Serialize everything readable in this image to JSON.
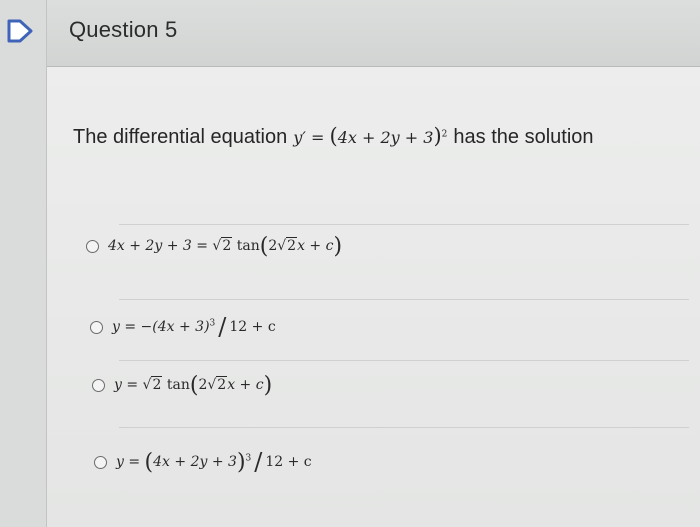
{
  "question": {
    "title": "Question 5",
    "text_before": "The differential equation",
    "equation": {
      "lhs": "y′ =",
      "open": "(",
      "inner": "4x + 2y + 3",
      "close": ")",
      "power": "2"
    },
    "text_after": "has the solution"
  },
  "options": [
    {
      "lhs": "4x + 2y + 3 =",
      "root_sign": "√",
      "root": "2",
      "func": "tan",
      "open": "(",
      "arg_a": "2",
      "arg_root_sign": "√",
      "arg_root": "2",
      "arg_b": "x + c",
      "close": ")"
    },
    {
      "lhs": "y = −(4x + 3)",
      "power": "3",
      "slash": "/",
      "rhs": "12 + c"
    },
    {
      "lhs": "y =",
      "root_sign": "√",
      "root": "2",
      "func": "tan",
      "open": "(",
      "arg_a": "2",
      "arg_root_sign": "√",
      "arg_root": "2",
      "arg_b": "x + c",
      "close": ")"
    },
    {
      "lhs": "y =",
      "open": "(",
      "inner": "4x + 2y + 3",
      "close": ")",
      "power": "3",
      "slash": "/",
      "rhs": "12 + c"
    }
  ]
}
